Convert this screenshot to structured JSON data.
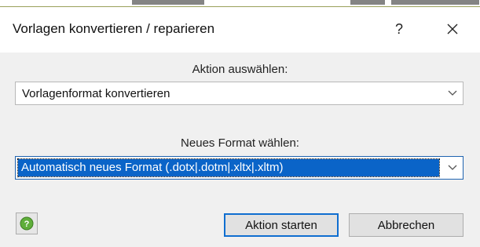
{
  "dialog": {
    "title": "Vorlagen konvertieren / reparieren",
    "help_glyph": "?",
    "close_glyph": "✕"
  },
  "action": {
    "label": "Aktion auswählen:",
    "selected": "Vorlagenformat konvertieren"
  },
  "format": {
    "label": "Neues Format wählen:",
    "selected": "Automatisch neues Format (.dotx|.dotm|.xltx|.xltm)"
  },
  "buttons": {
    "start": "Aktion starten",
    "cancel": "Abbrechen"
  },
  "icons": {
    "help": "help-question-icon",
    "dropdown": "chevron-down-icon",
    "close": "close-icon"
  },
  "colors": {
    "selection": "#0a64c8",
    "focus_border": "#0f6ed0",
    "help_green": "#5fae3a"
  }
}
